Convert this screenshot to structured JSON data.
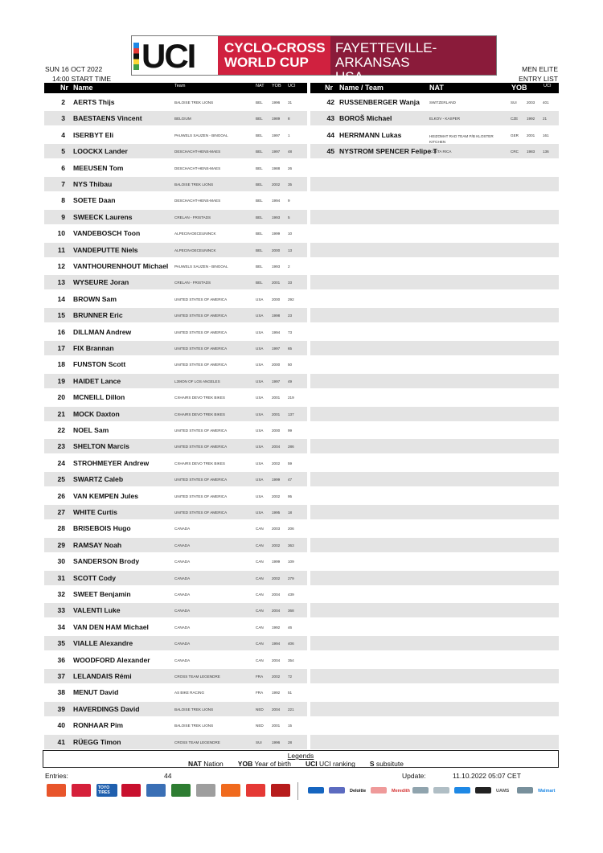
{
  "header": {
    "logo_text": "UCI",
    "event_line1": "CYCLO-CROSS",
    "event_line2": "WORLD CUP",
    "location_line1": "FAYETTEVILLE-ARKANSAS",
    "location_line2": "USA",
    "date": "SUN 16 OCT 2022",
    "start_time": "14:00 START TIME",
    "category": "MEN ELITE",
    "list_type": "ENTRY LIST",
    "brand_colors": {
      "red": "#d0213f",
      "maroon": "#8a1b3a"
    }
  },
  "left_table": {
    "columns": {
      "nr": "Nr",
      "name": "Name",
      "team": "Team",
      "nat": "NAT",
      "yob": "YOB",
      "uci": "UCI"
    },
    "rows": [
      [
        "2",
        "AERTS Thijs",
        "BALOISE TREK LIONS",
        "BEL",
        "1996",
        "31"
      ],
      [
        "3",
        "BAESTAENS Vincent",
        "BELGIUM",
        "BEL",
        "1989",
        "8"
      ],
      [
        "4",
        "ISERBYT Eli",
        "PAUWELS SAUZEN - BINGOAL",
        "BEL",
        "1997",
        "1"
      ],
      [
        "5",
        "LOOCKX Lander",
        "DESCHACHT-HENS-MAES",
        "BEL",
        "1997",
        "48"
      ],
      [
        "6",
        "MEEUSEN Tom",
        "DESCHACHT-HENS-MAES",
        "BEL",
        "1988",
        "26"
      ],
      [
        "7",
        "NYS Thibau",
        "BALOISE TREK LIONS",
        "BEL",
        "2002",
        "35"
      ],
      [
        "8",
        "SOETE Daan",
        "DESCHACHT-HENS-MAES",
        "BEL",
        "1994",
        "9"
      ],
      [
        "9",
        "SWEECK Laurens",
        "CRELAN - FRISTADS",
        "BEL",
        "1993",
        "5"
      ],
      [
        "10",
        "VANDEBOSCH Toon",
        "ALPECIN-DECEUNINCK",
        "BEL",
        "1999",
        "10"
      ],
      [
        "11",
        "VANDEPUTTE Niels",
        "ALPECIN-DECEUNINCK",
        "BEL",
        "2000",
        "13"
      ],
      [
        "12",
        "VANTHOURENHOUT Michael",
        "PAUWELS SAUZEN - BINGOAL",
        "BEL",
        "1993",
        "2"
      ],
      [
        "13",
        "WYSEURE Joran",
        "CRELAN - FRISTADS",
        "BEL",
        "2001",
        "33"
      ],
      [
        "14",
        "BROWN Sam",
        "UNITED STATES OF AMERICA",
        "USA",
        "2000",
        "292"
      ],
      [
        "15",
        "BRUNNER Eric",
        "UNITED STATES OF AMERICA",
        "USA",
        "1998",
        "23"
      ],
      [
        "16",
        "DILLMAN Andrew",
        "UNITED STATES OF AMERICA",
        "USA",
        "1994",
        "73"
      ],
      [
        "17",
        "FIX Brannan",
        "UNITED STATES OF AMERICA",
        "USA",
        "1997",
        "65"
      ],
      [
        "18",
        "FUNSTON Scott",
        "UNITED STATES OF AMERICA",
        "USA",
        "2000",
        "50"
      ],
      [
        "19",
        "HAIDET Lance",
        "L39ION OF LOS ANGELES",
        "USA",
        "1997",
        "49"
      ],
      [
        "20",
        "MCNEILL Dillon",
        "CXHAIRS DEVO TREK BIKES",
        "USA",
        "2001",
        "219"
      ],
      [
        "21",
        "MOCK Daxton",
        "CXHAIRS DEVO TREK BIKES",
        "USA",
        "2001",
        "137"
      ],
      [
        "22",
        "NOEL Sam",
        "UNITED STATES OF AMERICA",
        "USA",
        "2000",
        "99"
      ],
      [
        "23",
        "SHELTON Marcis",
        "UNITED STATES OF AMERICA",
        "USA",
        "2004",
        "286"
      ],
      [
        "24",
        "STROHMEYER Andrew",
        "CXHAIRS DEVO TREK BIKES",
        "USA",
        "2002",
        "59"
      ],
      [
        "25",
        "SWARTZ Caleb",
        "UNITED STATES OF AMERICA",
        "USA",
        "1999",
        "47"
      ],
      [
        "26",
        "VAN KEMPEN Jules",
        "UNITED STATES OF AMERICA",
        "USA",
        "2002",
        "95"
      ],
      [
        "27",
        "WHITE Curtis",
        "UNITED STATES OF AMERICA",
        "USA",
        "1995",
        "18"
      ],
      [
        "28",
        "BRISEBOIS Hugo",
        "CANADA",
        "CAN",
        "2003",
        "206"
      ],
      [
        "29",
        "RAMSAY Noah",
        "CANADA",
        "CAN",
        "2002",
        "363"
      ],
      [
        "30",
        "SANDERSON Brody",
        "CANADA",
        "CAN",
        "1999",
        "109"
      ],
      [
        "31",
        "SCOTT Cody",
        "CANADA",
        "CAN",
        "2002",
        "279"
      ],
      [
        "32",
        "SWEET Benjamin",
        "CANADA",
        "CAN",
        "2004",
        "439"
      ],
      [
        "33",
        "VALENTI Luke",
        "CANADA",
        "CAN",
        "2004",
        "368"
      ],
      [
        "34",
        "VAN DEN HAM Michael",
        "CANADA",
        "CAN",
        "1992",
        "46"
      ],
      [
        "35",
        "VIALLE Alexandre",
        "CANADA",
        "CAN",
        "1994",
        "406"
      ],
      [
        "36",
        "WOODFORD Alexander",
        "CANADA",
        "CAN",
        "2004",
        "354"
      ],
      [
        "37",
        "LELANDAIS Rémi",
        "CROSS TEAM LEGENDRE",
        "FRA",
        "2002",
        "72"
      ],
      [
        "38",
        "MENUT David",
        "AS BIKE RACING",
        "FRA",
        "1992",
        "51"
      ],
      [
        "39",
        "HAVERDINGS David",
        "BALOISE TREK LIONS",
        "NED",
        "2004",
        "221"
      ],
      [
        "40",
        "RONHAAR Pim",
        "BALOISE TREK LIONS",
        "NED",
        "2001",
        "15"
      ],
      [
        "41",
        "RÜEGG Timon",
        "CROSS TEAM LEGENDRE",
        "SUI",
        "1996",
        "28"
      ]
    ]
  },
  "right_table": {
    "columns": {
      "nr": "Nr",
      "name": "Name / Team",
      "nat": "NAT",
      "yob": "YOB",
      "uci": "UCI"
    },
    "rows": [
      [
        "42",
        "RUSSENBERGER Wanja",
        "SWITZERLAND",
        "SUI",
        "2003",
        "401"
      ],
      [
        "43",
        "BOROŠ Michael",
        "ELKOV - KASPER",
        "CZE",
        "1992",
        "21"
      ],
      [
        "44",
        "HERRMANN Lukas",
        "HEIZOMAT RAD TEAM P/B KLOSTER KITCHEN",
        "GER",
        "2001",
        "161"
      ],
      [
        "45",
        "NYSTROM SPENCER Felipe T",
        "COSTA RICA",
        "CRC",
        "1983",
        "136"
      ]
    ]
  },
  "legend": {
    "title": "Legends",
    "items": [
      {
        "key": "NAT",
        "label": "Nation"
      },
      {
        "key": "YOB",
        "label": "Year of birth"
      },
      {
        "key": "UCI",
        "label": "UCI ranking"
      },
      {
        "key": "S",
        "label": "subsitute"
      }
    ]
  },
  "footer": {
    "entries_label": "Entries:",
    "entries_value": "44",
    "update_label": "Update:",
    "update_value": "11.10.2022 05:07  CET"
  },
  "sponsors": [
    {
      "name": "eurotrias",
      "color": "#e8552b"
    },
    {
      "name": "jimmy",
      "color": "#d5203a"
    },
    {
      "name": "toyo tires",
      "color": "#1f5fae"
    },
    {
      "name": "panaria",
      "color": "#c8102e"
    },
    {
      "name": "shimano",
      "color": "#3a6fb5"
    },
    {
      "name": "A",
      "color": "#2e7d32"
    },
    {
      "name": "simac",
      "color": "#9e9e9e"
    },
    {
      "name": "stihl",
      "color": "#f06a1d"
    },
    {
      "name": "cycling",
      "color": "#e53935"
    },
    {
      "name": "duvel",
      "color": "#b71c1c"
    },
    {
      "name": "uci",
      "color": "#1565c0"
    },
    {
      "name": "allyst",
      "color": "#5c6bc0"
    },
    {
      "name": "Deloitte",
      "color": "#111111"
    },
    {
      "name": "brand",
      "color": "#ef9a9a"
    },
    {
      "name": "Meredith",
      "color": "#d32f2f"
    },
    {
      "name": "logo",
      "color": "#90a4ae"
    },
    {
      "name": "arkansas",
      "color": "#b0bec5"
    },
    {
      "name": "visit",
      "color": "#1e88e5"
    },
    {
      "name": "TREK",
      "color": "#222222"
    },
    {
      "name": "UAMS",
      "color": "#555555"
    },
    {
      "name": "brand2",
      "color": "#78909c"
    },
    {
      "name": "Walmart",
      "color": "#1e88e5"
    }
  ]
}
